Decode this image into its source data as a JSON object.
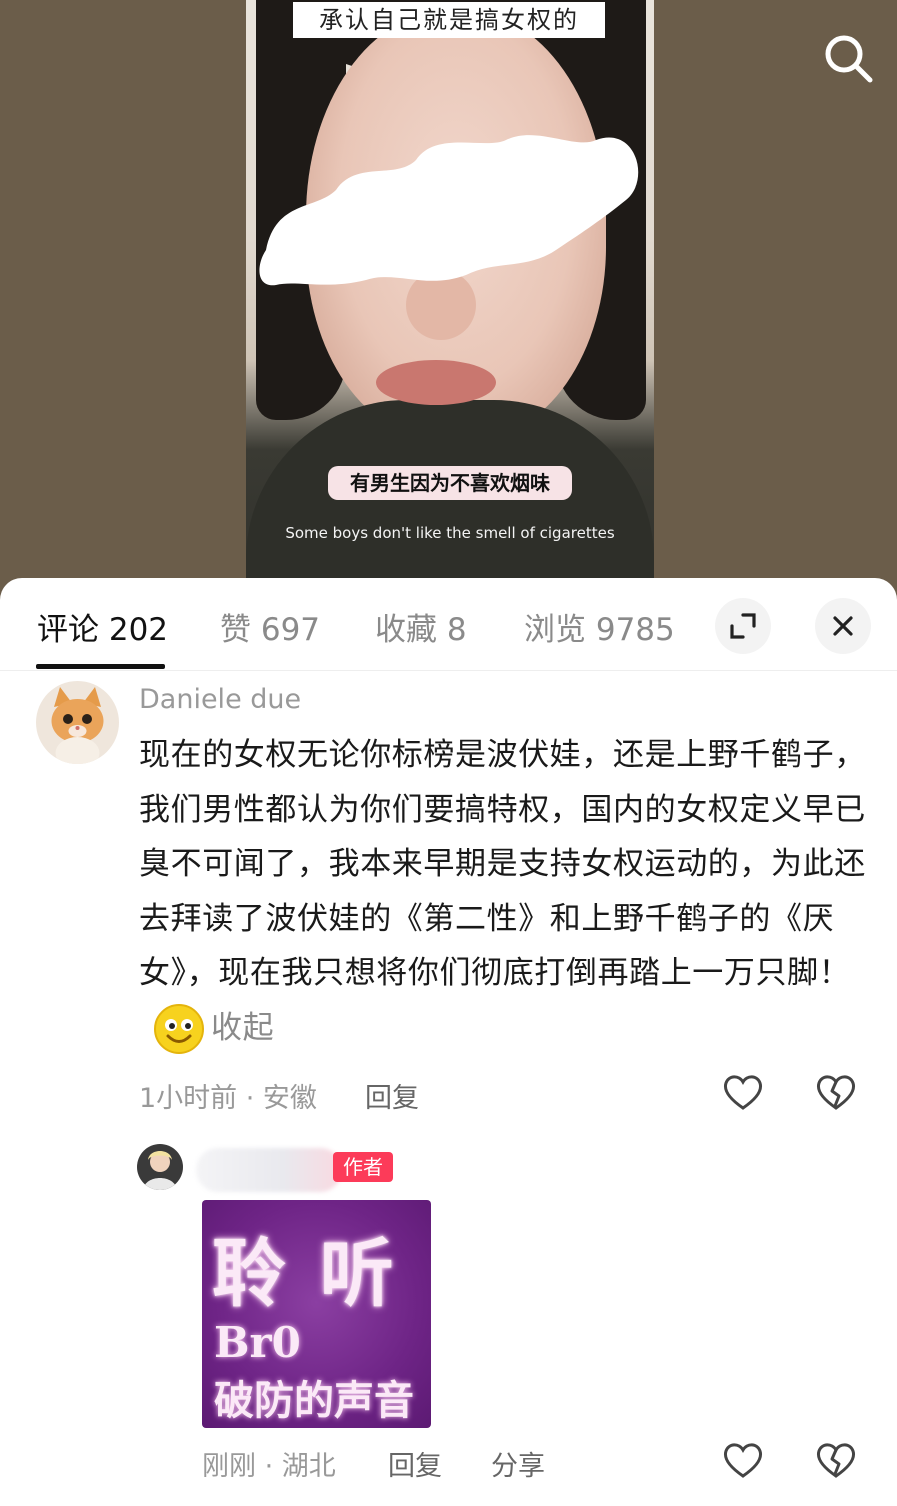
{
  "video": {
    "top_caption": "承认自己就是搞女权的",
    "subtitle_cn": "有男生因为不喜欢烟味",
    "subtitle_en": "Some boys don't like the smell of cigarettes",
    "search_icon": "search-icon"
  },
  "tabs": [
    {
      "label": "评论 202",
      "active": true
    },
    {
      "label": "赞 697",
      "active": false
    },
    {
      "label": "收藏 8",
      "active": false
    },
    {
      "label": "浏览 9785",
      "active": false
    }
  ],
  "header_buttons": {
    "expand_icon": "expand-icon",
    "close_icon": "close-icon"
  },
  "comment": {
    "username": "Daniele due",
    "avatar_icon": "cat-avatar",
    "text": "现在的女权无论你标榜是波伏娃，还是上野千鹤子，我们男性都认为你们要搞特权，国内的女权定义早已臭不可闻了，我本来早期是支持女权运动的，为此还去拜读了波伏娃的《第二性》和上野千鹤子的《厌女》，现在我只想将你们彻底打倒再踏上一万只脚！",
    "collapse_label": "收起",
    "time_location": "1小时前 · 安徽",
    "reply_label": "回复"
  },
  "reply": {
    "author_badge": "作者",
    "sticker": {
      "line1": "聆 听",
      "line2": "Br0",
      "line3": "破防的声音"
    },
    "time_location": "刚刚 · 湖北",
    "reply_label": "回复",
    "share_label": "分享"
  },
  "colors": {
    "accent": "#fc3b59",
    "text": "#1a1a1a",
    "muted": "#999999"
  }
}
